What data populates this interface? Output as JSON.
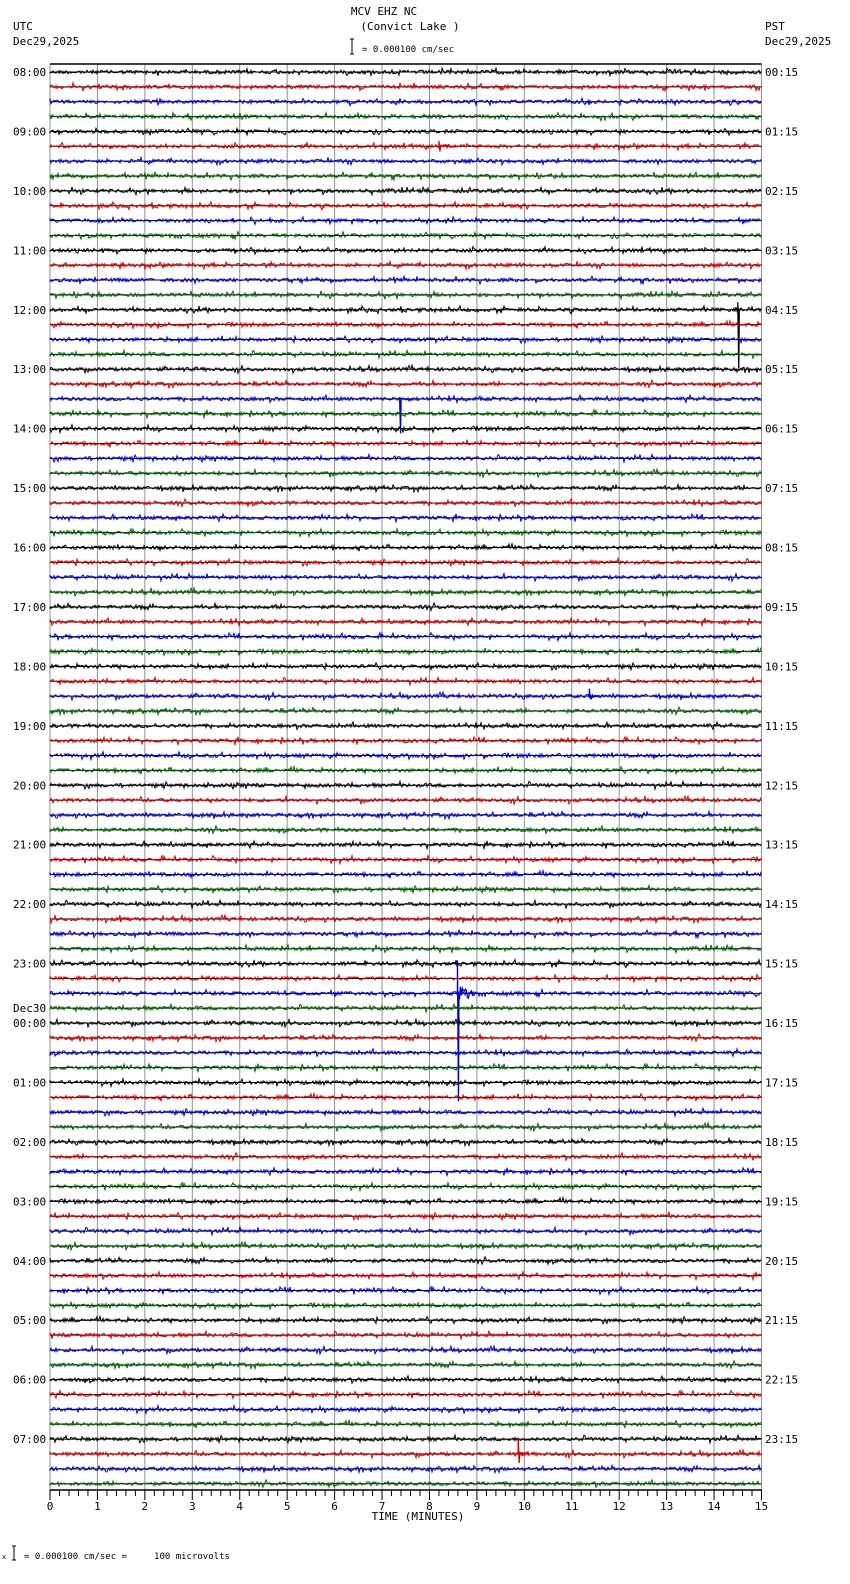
{
  "header": {
    "station": "MCV EHZ NC",
    "location": "(Convict Lake )",
    "left_zone": "UTC",
    "left_date": "Dec29,2025",
    "right_zone": "PST",
    "right_date": "Dec29,2025",
    "scale_text": "= 0.000100 cm/sec"
  },
  "footer": {
    "scale_text": "= 0.000100 cm/sec =     100 microvolts",
    "mark": "x"
  },
  "chart_data": {
    "type": "line",
    "title": "MCV EHZ NC (Convict Lake )",
    "xlabel": "TIME (MINUTES)",
    "xlim": [
      0,
      15
    ],
    "x_ticks": [
      "0",
      "1",
      "2",
      "3",
      "4",
      "5",
      "6",
      "7",
      "8",
      "9",
      "10",
      "11",
      "12",
      "13",
      "14",
      "15"
    ],
    "minor_tick_step_minutes": 0.2,
    "trace_minutes": 15,
    "trace_count": 96,
    "trace_colors": [
      "#000000",
      "#d40000",
      "#0000c8",
      "#006400"
    ],
    "amplitude_unit": "0.000100 cm/sec",
    "noise_amplitude": 0.12,
    "left_labels": [
      "08:00",
      "09:00",
      "10:00",
      "11:00",
      "12:00",
      "13:00",
      "14:00",
      "15:00",
      "16:00",
      "17:00",
      "18:00",
      "19:00",
      "20:00",
      "21:00",
      "22:00",
      "23:00",
      "00:00",
      "01:00",
      "02:00",
      "03:00",
      "04:00",
      "05:00",
      "06:00",
      "07:00"
    ],
    "right_labels": [
      "00:15",
      "01:15",
      "02:15",
      "03:15",
      "04:15",
      "05:15",
      "06:15",
      "07:15",
      "08:15",
      "09:15",
      "10:15",
      "11:15",
      "12:15",
      "13:15",
      "14:15",
      "15:15",
      "16:15",
      "17:15",
      "18:15",
      "19:15",
      "20:15",
      "21:15",
      "22:15",
      "23:15"
    ],
    "date_change": {
      "hour_index": 16,
      "label": "Dec30"
    },
    "events": [
      {
        "trace": 5,
        "minute": 8.2,
        "duration": 0.5,
        "up": 0.35,
        "down": 0.35
      },
      {
        "trace": 16,
        "minute": 14.5,
        "duration": 0.05,
        "up": 0.5,
        "down": 3.9
      },
      {
        "trace": 22,
        "minute": 7.37,
        "duration": 0.2,
        "up": 0.1,
        "down": 2.3
      },
      {
        "trace": 42,
        "minute": 11.37,
        "duration": 0.2,
        "up": 0.5,
        "down": 0.2
      },
      {
        "trace": 57,
        "minute": 1.47,
        "duration": 0.3,
        "up": 0.25,
        "down": 0.2
      },
      {
        "trace": 62,
        "minute": 8.59,
        "duration": 0.4,
        "up": 2.2,
        "down": 7.2
      },
      {
        "trace": 93,
        "minute": 9.87,
        "duration": 0.25,
        "up": 1.1,
        "down": 0.6
      }
    ]
  }
}
